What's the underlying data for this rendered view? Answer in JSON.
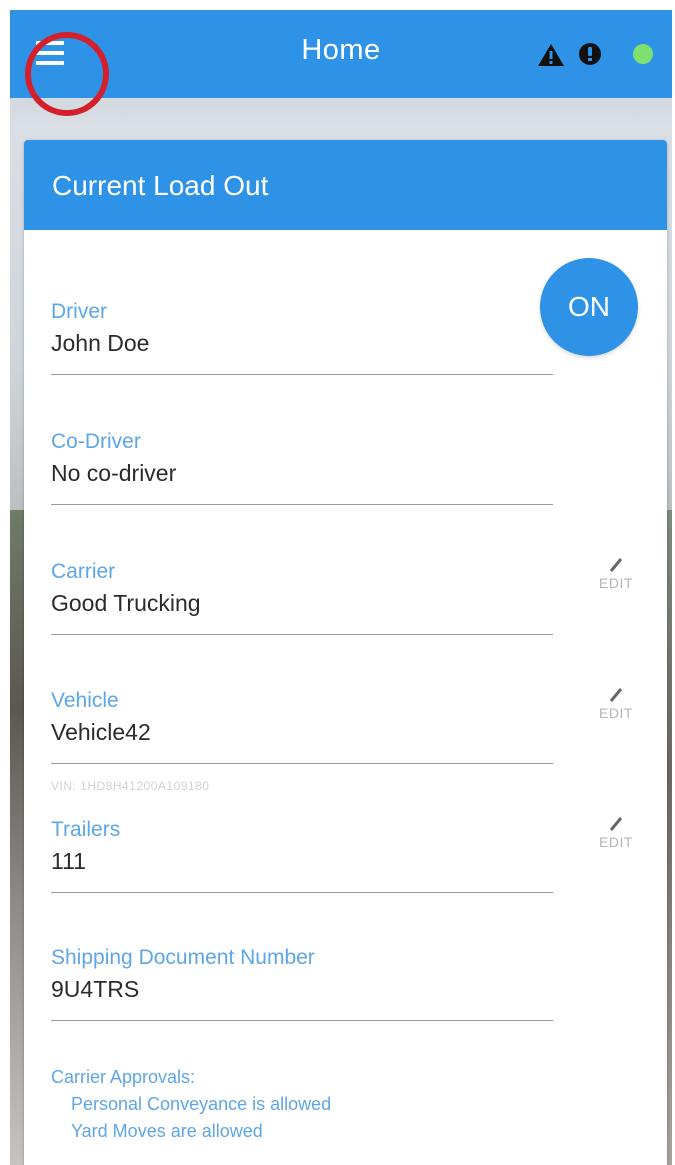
{
  "app_bar": {
    "title": "Home",
    "icons": [
      "menu-icon",
      "warning-icon",
      "alert-icon",
      "status-dot"
    ],
    "colors": {
      "bar": "#2e92e6",
      "status_dot": "#7ee06f",
      "highlight_ring": "#d4202c"
    }
  },
  "card": {
    "title": "Current Load Out",
    "on_button_label": "ON",
    "fields": {
      "driver": {
        "label": "Driver",
        "value": "John Doe"
      },
      "co_driver": {
        "label": "Co-Driver",
        "value": "No co-driver"
      },
      "carrier": {
        "label": "Carrier",
        "value": "Good Trucking",
        "edit_label": "EDIT"
      },
      "vehicle": {
        "label": "Vehicle",
        "value": "Vehicle42",
        "edit_label": "EDIT",
        "vin": "VIN: 1HD8H41200A109180"
      },
      "trailers": {
        "label": "Trailers",
        "value": "111",
        "edit_label": "EDIT"
      },
      "shipping": {
        "label": "Shipping Document Number",
        "value": "9U4TRS"
      }
    },
    "approvals": {
      "heading": "Carrier Approvals:",
      "items": [
        "Personal Conveyance is allowed",
        "Yard Moves are allowed"
      ]
    }
  }
}
